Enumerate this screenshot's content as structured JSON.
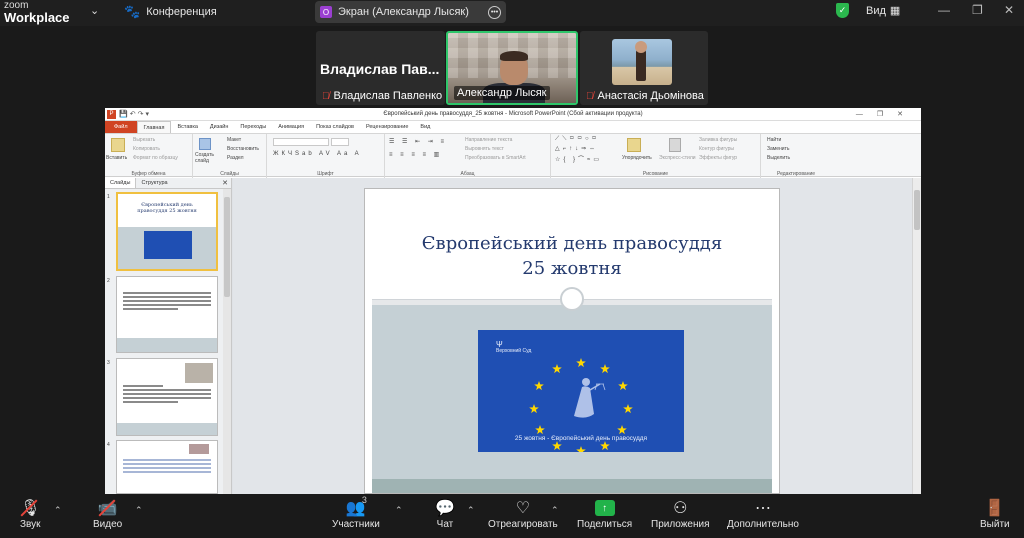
{
  "app": {
    "brand_line1": "zoom",
    "brand_line2": "Workplace",
    "conference_label": "Конференция",
    "screen_badge": "О",
    "screen_label": "Экран (Александр Лысяк)",
    "view_label": "Вид"
  },
  "participants": [
    {
      "display_big": "Владислав  Пав...",
      "name": "Владислав Павленко",
      "muted": true
    },
    {
      "name": "Александр Лысяк",
      "muted": false,
      "active_speaker": true
    },
    {
      "name": "Анастасія Дьомінова",
      "muted": true
    }
  ],
  "ppt": {
    "window_title": "Європейський день правосуддя_25 жовтня  -  Microsoft PowerPoint (Сбой активации продукта)",
    "tabs": [
      "Файл",
      "Главная",
      "Вставка",
      "Дизайн",
      "Переходы",
      "Анимация",
      "Показ слайдов",
      "Рецензирование",
      "Вид"
    ],
    "active_tab": "Главная",
    "groups": {
      "clipboard": "Буфер обмена",
      "slides": "Слайды",
      "font": "Шрифт",
      "paragraph": "Абзац",
      "drawing": "Рисование",
      "editing": "Редактирование"
    },
    "ribbon": {
      "paste": "Вставить",
      "cut": "Вырезать",
      "copy": "Копировать",
      "format_painter": "Формат по образцу",
      "new_slide": "Создать слайд",
      "layout": "Макет",
      "reset": "Восстановить",
      "section": "Раздел",
      "text_direction": "Направление текста",
      "align_text": "Выровнять текст",
      "smartart": "Преобразовать в SmartArt",
      "arrange": "Упорядочить",
      "quick_styles": "Экспресс-стили",
      "shape_fill": "Заливка фигуры",
      "shape_outline": "Контур фигуры",
      "shape_effects": "Эффекты фигур",
      "find": "Найти",
      "replace": "Заменить",
      "select": "Выделить"
    },
    "left_pane": {
      "tab_slides": "Слайды",
      "tab_outline": "Структура",
      "thumb1_title": "Європейський день правосуддя 25 жовтня",
      "nums": [
        "1",
        "2",
        "3",
        "4"
      ]
    },
    "slide": {
      "title_line1": "Європейський день правосуддя",
      "title_line2": "25 жовтня",
      "logo_text": "Верховний Суд",
      "caption": "25 жовтня - Європейський день правосуддя"
    }
  },
  "toolbar": {
    "audio": "Звук",
    "video": "Видео",
    "participants": "Участники",
    "participants_count": "3",
    "chat": "Чат",
    "react": "Отреагировать",
    "share": "Поделиться",
    "apps": "Приложения",
    "more": "Дополнительно",
    "leave": "Выйти"
  },
  "colors": {
    "speaker_border": "#2ec66a",
    "share_green": "#22b34a",
    "muted_red": "#e5443a",
    "ppt_file_tab": "#d04423",
    "eu_blue": "#1f4fb3",
    "star_yellow": "#ffd700"
  }
}
